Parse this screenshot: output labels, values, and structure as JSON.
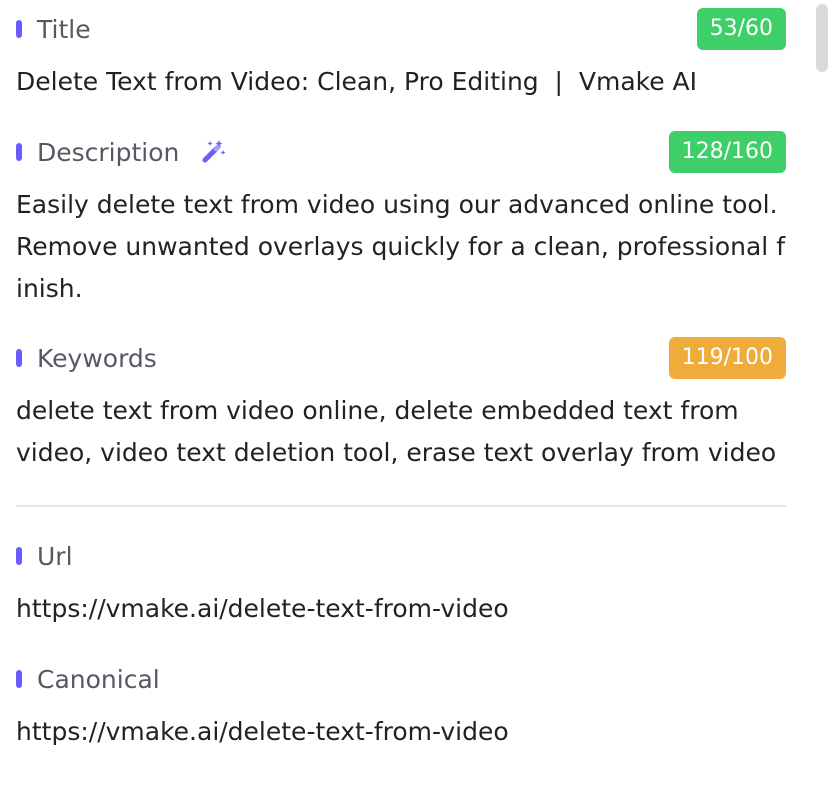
{
  "seo": {
    "title": {
      "label": "Title",
      "count": "53/60",
      "value": "Delete Text from Video: Clean, Pro Editing  |  Vmake AI",
      "badge_color": "#3ecf68"
    },
    "description": {
      "label": "Description",
      "icon": "magic-wand-icon",
      "count": "128/160",
      "value": "Easily delete text from video using our advanced online tool. Remove unwanted overlays quickly for a clean, professional finish.",
      "badge_color": "#3ecf68"
    },
    "keywords": {
      "label": "Keywords",
      "count": "119/100",
      "value": "delete text from video online, delete embedded text from video, video text deletion tool, erase text overlay from video",
      "badge_color": "#f0ac3a"
    },
    "url": {
      "label": "Url",
      "value": "https://vmake.ai/delete-text-from-video"
    },
    "canonical": {
      "label": "Canonical",
      "value": "https://vmake.ai/delete-text-from-video"
    }
  },
  "colors": {
    "marker": "#6a5cff",
    "ok": "#3ecf68",
    "warn": "#f0ac3a"
  }
}
